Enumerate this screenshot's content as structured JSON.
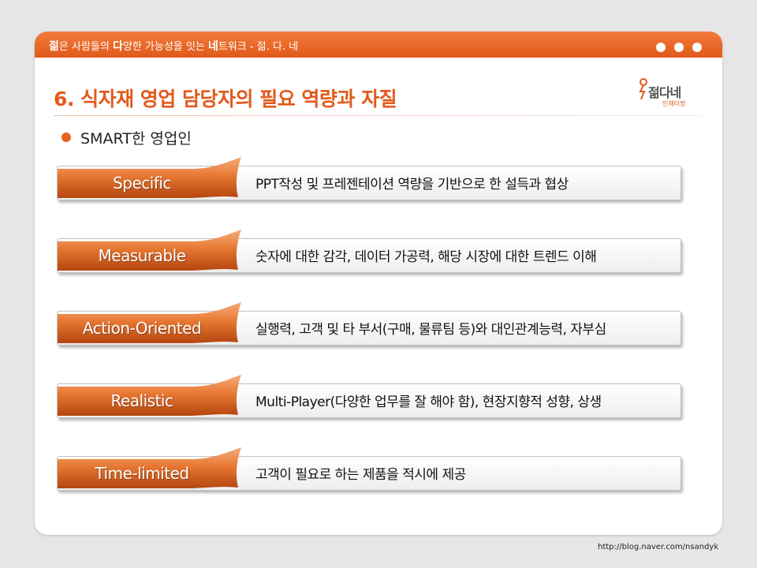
{
  "header": {
    "tagline_parts": [
      "젊",
      "은 사람들의 ",
      "다",
      "양한 가능성을 잇는 ",
      "네",
      "트워크 - 젊. 다. 네"
    ]
  },
  "title": "6. 식자재 영업 담당자의 필요 역량과 자질",
  "logo": {
    "name": "젊다네",
    "sub": "인재터방"
  },
  "bullet": "SMART한 영업인",
  "items": [
    {
      "category": "Specific",
      "description": "PPT작성 및 프레젠테이션 역량을 기반으로 한 설득과 협상"
    },
    {
      "category": "Measurable",
      "description": "숫자에 대한 감각, 데이터 가공력, 해당 시장에 대한 트렌드 이해"
    },
    {
      "category": "Action-Oriented",
      "description": "실행력, 고객 및 타 부서(구매, 물류팀 등)와 대인관계능력, 자부심"
    },
    {
      "category": "Realistic",
      "description": "Multi-Player(다양한 업무를 잘 해야 함), 현장지향적 성향, 상생"
    },
    {
      "category": "Time-limited",
      "description": "고객이 필요로 하는 제품을 적시에 제공"
    }
  ],
  "footer_url": "http://blog.naver.com/nsandyk",
  "colors": {
    "accent": "#e25a1c",
    "ribbon_light": "#f0a06e",
    "ribbon_dark": "#b5460f"
  }
}
